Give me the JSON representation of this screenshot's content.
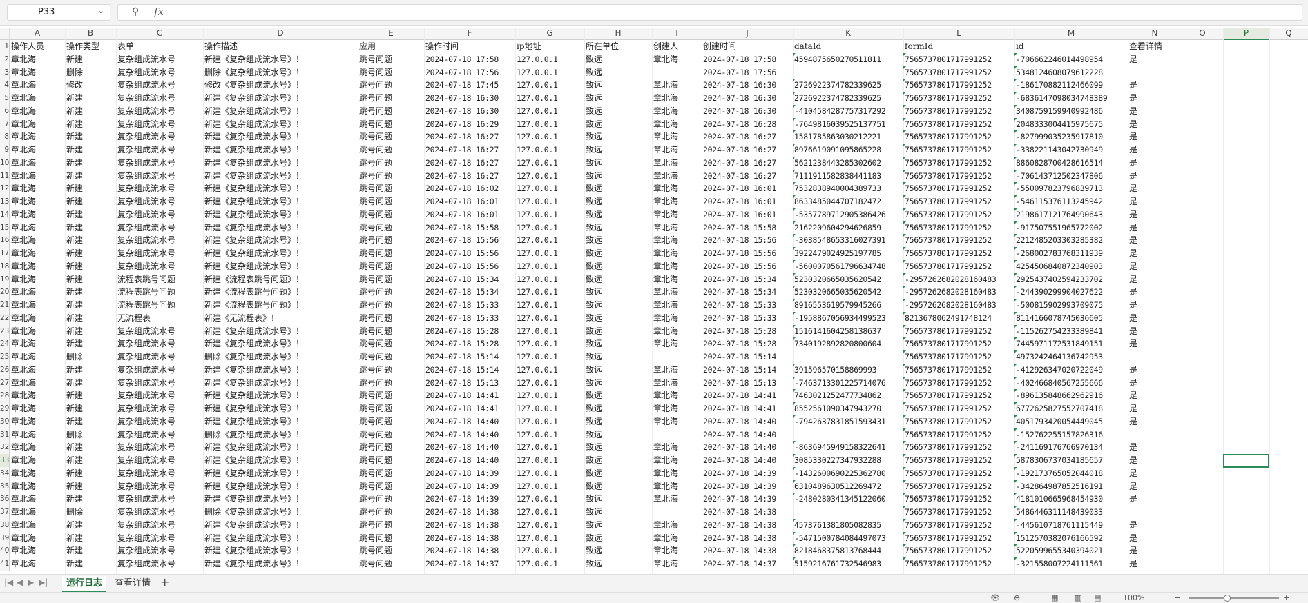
{
  "formula_bar": {
    "name_box": "P33",
    "fx_label": "fx",
    "formula": ""
  },
  "columns": [
    "A",
    "B",
    "C",
    "D",
    "E",
    "F",
    "G",
    "H",
    "I",
    "J",
    "K",
    "L",
    "M",
    "N",
    "O",
    "P",
    "Q"
  ],
  "selected_column": "P",
  "selected_row": "33",
  "rows": [
    [
      "操作人员",
      "操作类型",
      "表单",
      "操作描述",
      "应用",
      "操作时间",
      "ip地址",
      "所在单位",
      "创建人",
      "创建时间",
      "dataId",
      "formId",
      "id",
      "查看详情"
    ],
    [
      "章北海",
      "新建",
      "复杂组成流水号",
      "新建《复杂组成流水号》！",
      "跳号问题",
      "2024-07-18 17:58",
      "127.0.0.1",
      "致远",
      "章北海",
      "2024-07-18 17:58",
      "4594875650270511811",
      "7565737801717991252",
      "-706662246014498954",
      "是"
    ],
    [
      "章北海",
      "删除",
      "复杂组成流水号",
      "删除《复杂组成流水号》！",
      "跳号问题",
      "2024-07-18 17:56",
      "127.0.0.1",
      "致远",
      "",
      "2024-07-18 17:56",
      "",
      "7565737801717991252",
      "5348124608079612228",
      ""
    ],
    [
      "章北海",
      "修改",
      "复杂组成流水号",
      "修改《复杂组成流水号》！",
      "跳号问题",
      "2024-07-18 17:45",
      "127.0.0.1",
      "致远",
      "章北海",
      "2024-07-18 16:30",
      "2726922374782339625",
      "7565737801717991252",
      "-186170882112466099",
      "是"
    ],
    [
      "章北海",
      "新建",
      "复杂组成流水号",
      "新建《复杂组成流水号》！",
      "跳号问题",
      "2024-07-18 16:30",
      "127.0.0.1",
      "致远",
      "章北海",
      "2024-07-18 16:30",
      "2726922374782339625",
      "7565737801717991252",
      "-6836147098034748389",
      "是"
    ],
    [
      "章北海",
      "新建",
      "复杂组成流水号",
      "新建《复杂组成流水号》！",
      "跳号问题",
      "2024-07-18 16:30",
      "127.0.0.1",
      "致远",
      "章北海",
      "2024-07-18 16:30",
      "-4104584287757317292",
      "7565737801717991252",
      "3408759159940992486",
      "是"
    ],
    [
      "章北海",
      "新建",
      "复杂组成流水号",
      "新建《复杂组成流水号》！",
      "跳号问题",
      "2024-07-18 16:29",
      "127.0.0.1",
      "致远",
      "章北海",
      "2024-07-18 16:28",
      "-7649816039525137751",
      "7565737801717991252",
      "2048333004415975675",
      "是"
    ],
    [
      "章北海",
      "新建",
      "复杂组成流水号",
      "新建《复杂组成流水号》！",
      "跳号问题",
      "2024-07-18 16:27",
      "127.0.0.1",
      "致远",
      "章北海",
      "2024-07-18 16:27",
      "1581785863030212221",
      "7565737801717991252",
      "-827999035235917810",
      "是"
    ],
    [
      "章北海",
      "新建",
      "复杂组成流水号",
      "新建《复杂组成流水号》！",
      "跳号问题",
      "2024-07-18 16:27",
      "127.0.0.1",
      "致远",
      "章北海",
      "2024-07-18 16:27",
      "8976619091095865228",
      "7565737801717991252",
      "-338221143042730949",
      "是"
    ],
    [
      "章北海",
      "新建",
      "复杂组成流水号",
      "新建《复杂组成流水号》！",
      "跳号问题",
      "2024-07-18 16:27",
      "127.0.0.1",
      "致远",
      "章北海",
      "2024-07-18 16:27",
      "5621238443285302602",
      "7565737801717991252",
      "8860828700428616514",
      "是"
    ],
    [
      "章北海",
      "新建",
      "复杂组成流水号",
      "新建《复杂组成流水号》！",
      "跳号问题",
      "2024-07-18 16:27",
      "127.0.0.1",
      "致远",
      "章北海",
      "2024-07-18 16:27",
      "7111911582838441183",
      "7565737801717991252",
      "-706143712502347806",
      "是"
    ],
    [
      "章北海",
      "新建",
      "复杂组成流水号",
      "新建《复杂组成流水号》！",
      "跳号问题",
      "2024-07-18 16:02",
      "127.0.0.1",
      "致远",
      "章北海",
      "2024-07-18 16:01",
      "7532838940004389733",
      "7565737801717991252",
      "-550097823796839713",
      "是"
    ],
    [
      "章北海",
      "新建",
      "复杂组成流水号",
      "新建《复杂组成流水号》！",
      "跳号问题",
      "2024-07-18 16:01",
      "127.0.0.1",
      "致远",
      "章北海",
      "2024-07-18 16:01",
      "8633485044707182472",
      "7565737801717991252",
      "-546115376113245942",
      "是"
    ],
    [
      "章北海",
      "新建",
      "复杂组成流水号",
      "新建《复杂组成流水号》！",
      "跳号问题",
      "2024-07-18 16:01",
      "127.0.0.1",
      "致远",
      "章北海",
      "2024-07-18 16:01",
      "-5357789712905386426",
      "7565737801717991252",
      "2198617121764990643",
      "是"
    ],
    [
      "章北海",
      "新建",
      "复杂组成流水号",
      "新建《复杂组成流水号》！",
      "跳号问题",
      "2024-07-18 15:58",
      "127.0.0.1",
      "致远",
      "章北海",
      "2024-07-18 15:58",
      "2162209604294626859",
      "7565737801717991252",
      "-917507551965772002",
      "是"
    ],
    [
      "章北海",
      "新建",
      "复杂组成流水号",
      "新建《复杂组成流水号》！",
      "跳号问题",
      "2024-07-18 15:56",
      "127.0.0.1",
      "致远",
      "章北海",
      "2024-07-18 15:56",
      "-3038548653316027391",
      "7565737801717991252",
      "2212485203303285382",
      "是"
    ],
    [
      "章北海",
      "新建",
      "复杂组成流水号",
      "新建《复杂组成流水号》！",
      "跳号问题",
      "2024-07-18 15:56",
      "127.0.0.1",
      "致远",
      "章北海",
      "2024-07-18 15:56",
      "3922479024925197785",
      "7565737801717991252",
      "-268002783768311939",
      "是"
    ],
    [
      "章北海",
      "新建",
      "复杂组成流水号",
      "新建《复杂组成流水号》！",
      "跳号问题",
      "2024-07-18 15:56",
      "127.0.0.1",
      "致远",
      "章北海",
      "2024-07-18 15:56",
      "-5600070561796634748",
      "7565737801717991252",
      "4254506840872340903",
      "是"
    ],
    [
      "章北海",
      "新建",
      "流程表跳号问题",
      "新建《流程表跳号问题》！",
      "跳号问题",
      "2024-07-18 15:34",
      "127.0.0.1",
      "致远",
      "章北海",
      "2024-07-18 15:34",
      "5230320665035620542",
      "-2957262682028160483",
      "2925437402594233702",
      "是"
    ],
    [
      "章北海",
      "新建",
      "流程表跳号问题",
      "新建《流程表跳号问题》！",
      "跳号问题",
      "2024-07-18 15:34",
      "127.0.0.1",
      "致远",
      "章北海",
      "2024-07-18 15:34",
      "5230320665035620542",
      "-2957262682028160483",
      "-244390299904027622",
      "是"
    ],
    [
      "章北海",
      "新建",
      "流程表跳号问题",
      "新建《流程表跳号问题》！",
      "跳号问题",
      "2024-07-18 15:33",
      "127.0.0.1",
      "致远",
      "章北海",
      "2024-07-18 15:33",
      "8916553619579945266",
      "-2957262682028160483",
      "-500815902993709075",
      "是"
    ],
    [
      "章北海",
      "新建",
      "无流程表",
      "新建《无流程表》！",
      "跳号问题",
      "2024-07-18 15:33",
      "127.0.0.1",
      "致远",
      "章北海",
      "2024-07-18 15:33",
      "-1958867056934499523",
      "8213678062491748124",
      "8114166078745036605",
      "是"
    ],
    [
      "章北海",
      "新建",
      "复杂组成流水号",
      "新建《复杂组成流水号》！",
      "跳号问题",
      "2024-07-18 15:28",
      "127.0.0.1",
      "致远",
      "章北海",
      "2024-07-18 15:28",
      "1516141604258138637",
      "7565737801717991252",
      "-115262754233389841",
      "是"
    ],
    [
      "章北海",
      "新建",
      "复杂组成流水号",
      "新建《复杂组成流水号》！",
      "跳号问题",
      "2024-07-18 15:28",
      "127.0.0.1",
      "致远",
      "章北海",
      "2024-07-18 15:28",
      "7340192892820800604",
      "7565737801717991252",
      "7445971172531849151",
      "是"
    ],
    [
      "章北海",
      "删除",
      "复杂组成流水号",
      "删除《复杂组成流水号》！",
      "跳号问题",
      "2024-07-18 15:14",
      "127.0.0.1",
      "致远",
      "",
      "2024-07-18 15:14",
      "",
      "7565737801717991252",
      "4973242464136742953",
      ""
    ],
    [
      "章北海",
      "新建",
      "复杂组成流水号",
      "新建《复杂组成流水号》！",
      "跳号问题",
      "2024-07-18 15:14",
      "127.0.0.1",
      "致远",
      "章北海",
      "2024-07-18 15:14",
      "391596570158869993",
      "7565737801717991252",
      "-412926347020722049",
      "是"
    ],
    [
      "章北海",
      "新建",
      "复杂组成流水号",
      "新建《复杂组成流水号》！",
      "跳号问题",
      "2024-07-18 15:13",
      "127.0.0.1",
      "致远",
      "章北海",
      "2024-07-18 15:13",
      "-7463713301225714076",
      "7565737801717991252",
      "-402466840567255666",
      "是"
    ],
    [
      "章北海",
      "新建",
      "复杂组成流水号",
      "新建《复杂组成流水号》！",
      "跳号问题",
      "2024-07-18 14:41",
      "127.0.0.1",
      "致远",
      "章北海",
      "2024-07-18 14:41",
      "7463021252477734862",
      "7565737801717991252",
      "-896135848662962916",
      "是"
    ],
    [
      "章北海",
      "新建",
      "复杂组成流水号",
      "新建《复杂组成流水号》！",
      "跳号问题",
      "2024-07-18 14:41",
      "127.0.0.1",
      "致远",
      "章北海",
      "2024-07-18 14:41",
      "8552561090347943270",
      "7565737801717991252",
      "6772625827552707418",
      "是"
    ],
    [
      "章北海",
      "新建",
      "复杂组成流水号",
      "新建《复杂组成流水号》！",
      "跳号问题",
      "2024-07-18 14:40",
      "127.0.0.1",
      "致远",
      "章北海",
      "2024-07-18 14:40",
      "-7942637831851593431",
      "7565737801717991252",
      "4051793420054449045",
      "是"
    ],
    [
      "章北海",
      "删除",
      "复杂组成流水号",
      "删除《复杂组成流水号》！",
      "跳号问题",
      "2024-07-18 14:40",
      "127.0.0.1",
      "致远",
      "",
      "2024-07-18 14:40",
      "",
      "7565737801717991252",
      "-152762255157826316",
      ""
    ],
    [
      "章北海",
      "新建",
      "复杂组成流水号",
      "新建《复杂组成流水号》！",
      "跳号问题",
      "2024-07-18 14:40",
      "127.0.0.1",
      "致远",
      "章北海",
      "2024-07-18 14:40",
      "-8636945949158322641",
      "7565737801717991252",
      "-241169176766970134",
      "是"
    ],
    [
      "章北海",
      "新建",
      "复杂组成流水号",
      "新建《复杂组成流水号》！",
      "跳号问题",
      "2024-07-18 14:40",
      "127.0.0.1",
      "致远",
      "章北海",
      "2024-07-18 14:40",
      "3085330227347932288",
      "7565737801717991252",
      "5878306737034185657",
      "是"
    ],
    [
      "章北海",
      "新建",
      "复杂组成流水号",
      "新建《复杂组成流水号》！",
      "跳号问题",
      "2024-07-18 14:39",
      "127.0.0.1",
      "致远",
      "章北海",
      "2024-07-18 14:39",
      "-1432600690225362780",
      "7565737801717991252",
      "-192173765052044018",
      "是"
    ],
    [
      "章北海",
      "新建",
      "复杂组成流水号",
      "新建《复杂组成流水号》！",
      "跳号问题",
      "2024-07-18 14:39",
      "127.0.0.1",
      "致远",
      "章北海",
      "2024-07-18 14:39",
      "6310489630512269472",
      "7565737801717991252",
      "-342864987852516191",
      "是"
    ],
    [
      "章北海",
      "新建",
      "复杂组成流水号",
      "新建《复杂组成流水号》！",
      "跳号问题",
      "2024-07-18 14:39",
      "127.0.0.1",
      "致远",
      "章北海",
      "2024-07-18 14:39",
      "-2480280341345122060",
      "7565737801717991252",
      "4181010665968454930",
      "是"
    ],
    [
      "章北海",
      "删除",
      "复杂组成流水号",
      "删除《复杂组成流水号》！",
      "跳号问题",
      "2024-07-18 14:38",
      "127.0.0.1",
      "致远",
      "",
      "2024-07-18 14:38",
      "",
      "7565737801717991252",
      "5486446311148439033",
      ""
    ],
    [
      "章北海",
      "新建",
      "复杂组成流水号",
      "新建《复杂组成流水号》！",
      "跳号问题",
      "2024-07-18 14:38",
      "127.0.0.1",
      "致远",
      "章北海",
      "2024-07-18 14:38",
      "4573761381805082835",
      "7565737801717991252",
      "-445610718761115449",
      "是"
    ],
    [
      "章北海",
      "新建",
      "复杂组成流水号",
      "新建《复杂组成流水号》！",
      "跳号问题",
      "2024-07-18 14:38",
      "127.0.0.1",
      "致远",
      "章北海",
      "2024-07-18 14:38",
      "-5471500784084497073",
      "7565737801717991252",
      "1512570382076166592",
      "是"
    ],
    [
      "章北海",
      "新建",
      "复杂组成流水号",
      "新建《复杂组成流水号》！",
      "跳号问题",
      "2024-07-18 14:38",
      "127.0.0.1",
      "致远",
      "章北海",
      "2024-07-18 14:38",
      "8218468375813768444",
      "7565737801717991252",
      "5220599655340394021",
      "是"
    ],
    [
      "章北海",
      "新建",
      "复杂组成流水号",
      "新建《复杂组成流水号》！",
      "跳号问题",
      "2024-07-18 14:37",
      "127.0.0.1",
      "致远",
      "章北海",
      "2024-07-18 14:37",
      "5159216761732546983",
      "7565737801717991252",
      "-321558007224111561",
      "是"
    ]
  ],
  "sheet_tabs": [
    "运行日志",
    "查看详情"
  ],
  "active_tab": "运行日志",
  "status": {
    "zoom": "100%"
  }
}
